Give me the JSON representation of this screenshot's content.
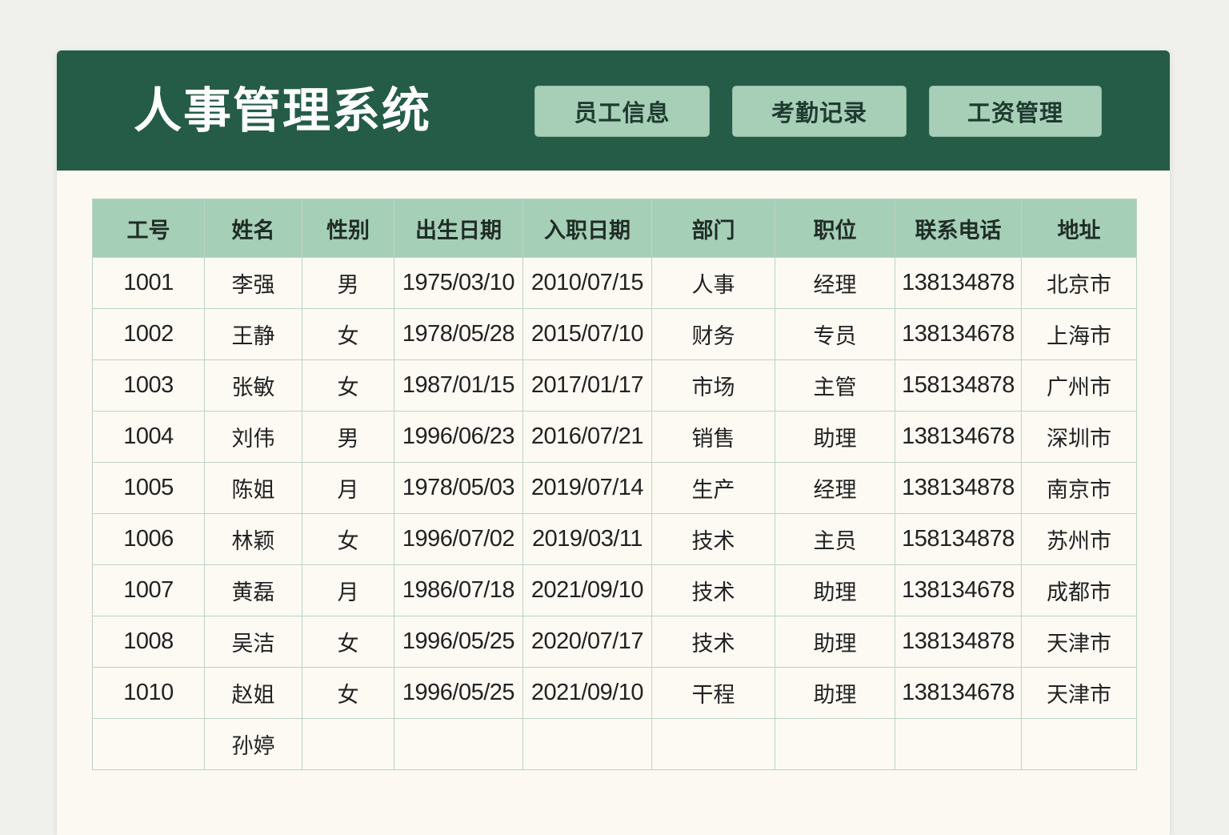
{
  "app": {
    "title": "人事管理系统",
    "nav": [
      {
        "label": "员工信息"
      },
      {
        "label": "考勤记录"
      },
      {
        "label": "工资管理"
      }
    ]
  },
  "colors": {
    "header_bg": "#245c48",
    "button_bg": "#a7cfb8",
    "table_header_bg": "#a6cfb7",
    "panel_bg": "#fbf9f1"
  },
  "table": {
    "columns": [
      "工号",
      "姓名",
      "性别",
      "出生日期",
      "入职日期",
      "部门",
      "职位",
      "联系电话",
      "地址"
    ],
    "rows": [
      [
        "1001",
        "李强",
        "男",
        "1975/03/10",
        "2010/07/15",
        "人事",
        "经理",
        "138134878",
        "北京市"
      ],
      [
        "1002",
        "王静",
        "女",
        "1978/05/28",
        "2015/07/10",
        "财务",
        "专员",
        "138134678",
        "上海市"
      ],
      [
        "1003",
        "张敏",
        "女",
        "1987/01/15",
        "2017/01/17",
        "市场",
        "主管",
        "158134878",
        "广州市"
      ],
      [
        "1004",
        "刘伟",
        "男",
        "1996/06/23",
        "2016/07/21",
        "销售",
        "助理",
        "138134678",
        "深圳市"
      ],
      [
        "1005",
        "陈姐",
        "月",
        "1978/05/03",
        "2019/07/14",
        "生产",
        "经理",
        "138134878",
        "南京市"
      ],
      [
        "1006",
        "林颖",
        "女",
        "1996/07/02",
        "2019/03/11",
        "技术",
        "主员",
        "158134878",
        "苏州市"
      ],
      [
        "1007",
        "黄磊",
        "月",
        "1986/07/18",
        "2021/09/10",
        "技术",
        "助理",
        "138134678",
        "成都市"
      ],
      [
        "1008",
        "吴洁",
        "女",
        "1996/05/25",
        "2020/07/17",
        "技术",
        "助理",
        "138134878",
        "天津市"
      ],
      [
        "1010",
        "赵姐",
        "女",
        "1996/05/25",
        "2021/09/10",
        "干程",
        "助理",
        "138134678",
        "天津市"
      ],
      [
        "",
        "孙婷",
        "",
        "",
        "",
        "",
        "",
        "",
        ""
      ]
    ]
  }
}
